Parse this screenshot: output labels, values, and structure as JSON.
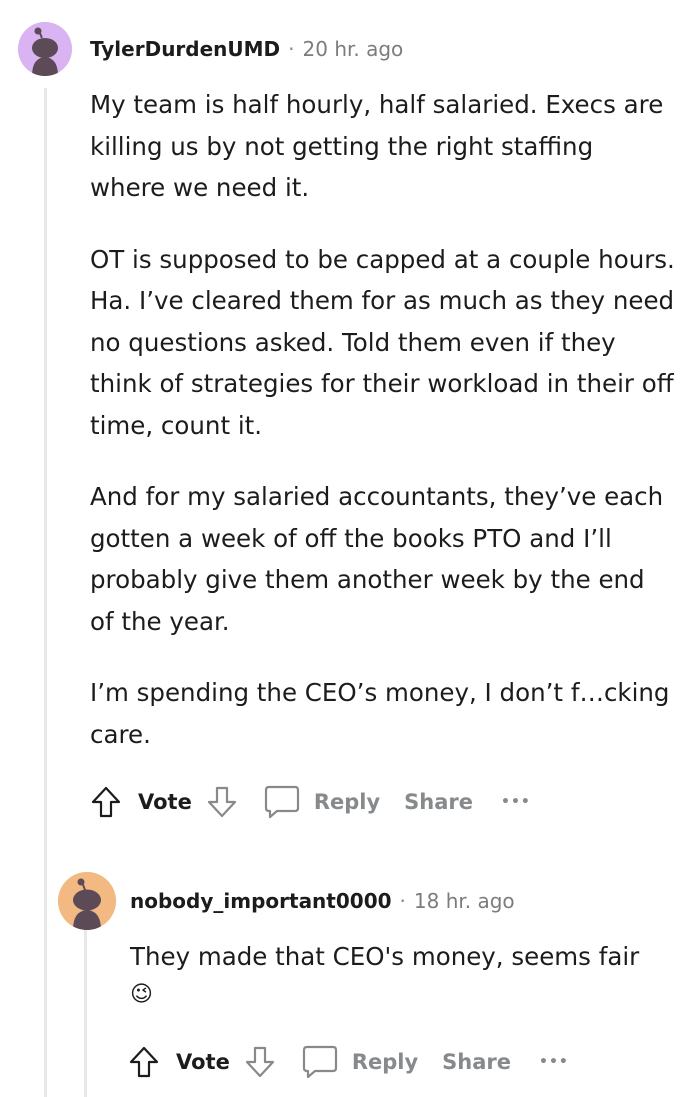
{
  "comment": {
    "username": "TylerDurdenUMD",
    "separator": "·",
    "age": "20 hr. ago",
    "paragraphs": [
      "My team is half hourly, half salaried. Execs are killing us by not getting the right staffing where we need it.",
      "OT is supposed to be capped at a couple hours. Ha. I’ve cleared them for as much as they need no questions asked. Told them even if they think of strategies for their workload in their off time, count it.",
      "And for my salaried accountants, they’ve each gotten a week of off the books PTO and I’ll probably give them another week by the end of the year.",
      "I’m spending the CEO’s money, I don’t f…cking care."
    ],
    "actions": {
      "vote": "Vote",
      "reply": "Reply",
      "share": "Share",
      "more": "•••"
    }
  },
  "reply": {
    "username": "nobody_important0000",
    "separator": "·",
    "age": "18 hr. ago",
    "text": "They made that CEO's money, seems fair",
    "emoji": "😉",
    "actions": {
      "vote": "Vote",
      "reply": "Reply",
      "share": "Share",
      "more": "•••"
    }
  },
  "colors": {
    "avatar1_bg": "#d9b3f2",
    "avatar2_bg": "#f2b982",
    "avatar_figure": "#5c4a57",
    "thread_line": "#e8e8e8",
    "muted": "#878a8c"
  }
}
